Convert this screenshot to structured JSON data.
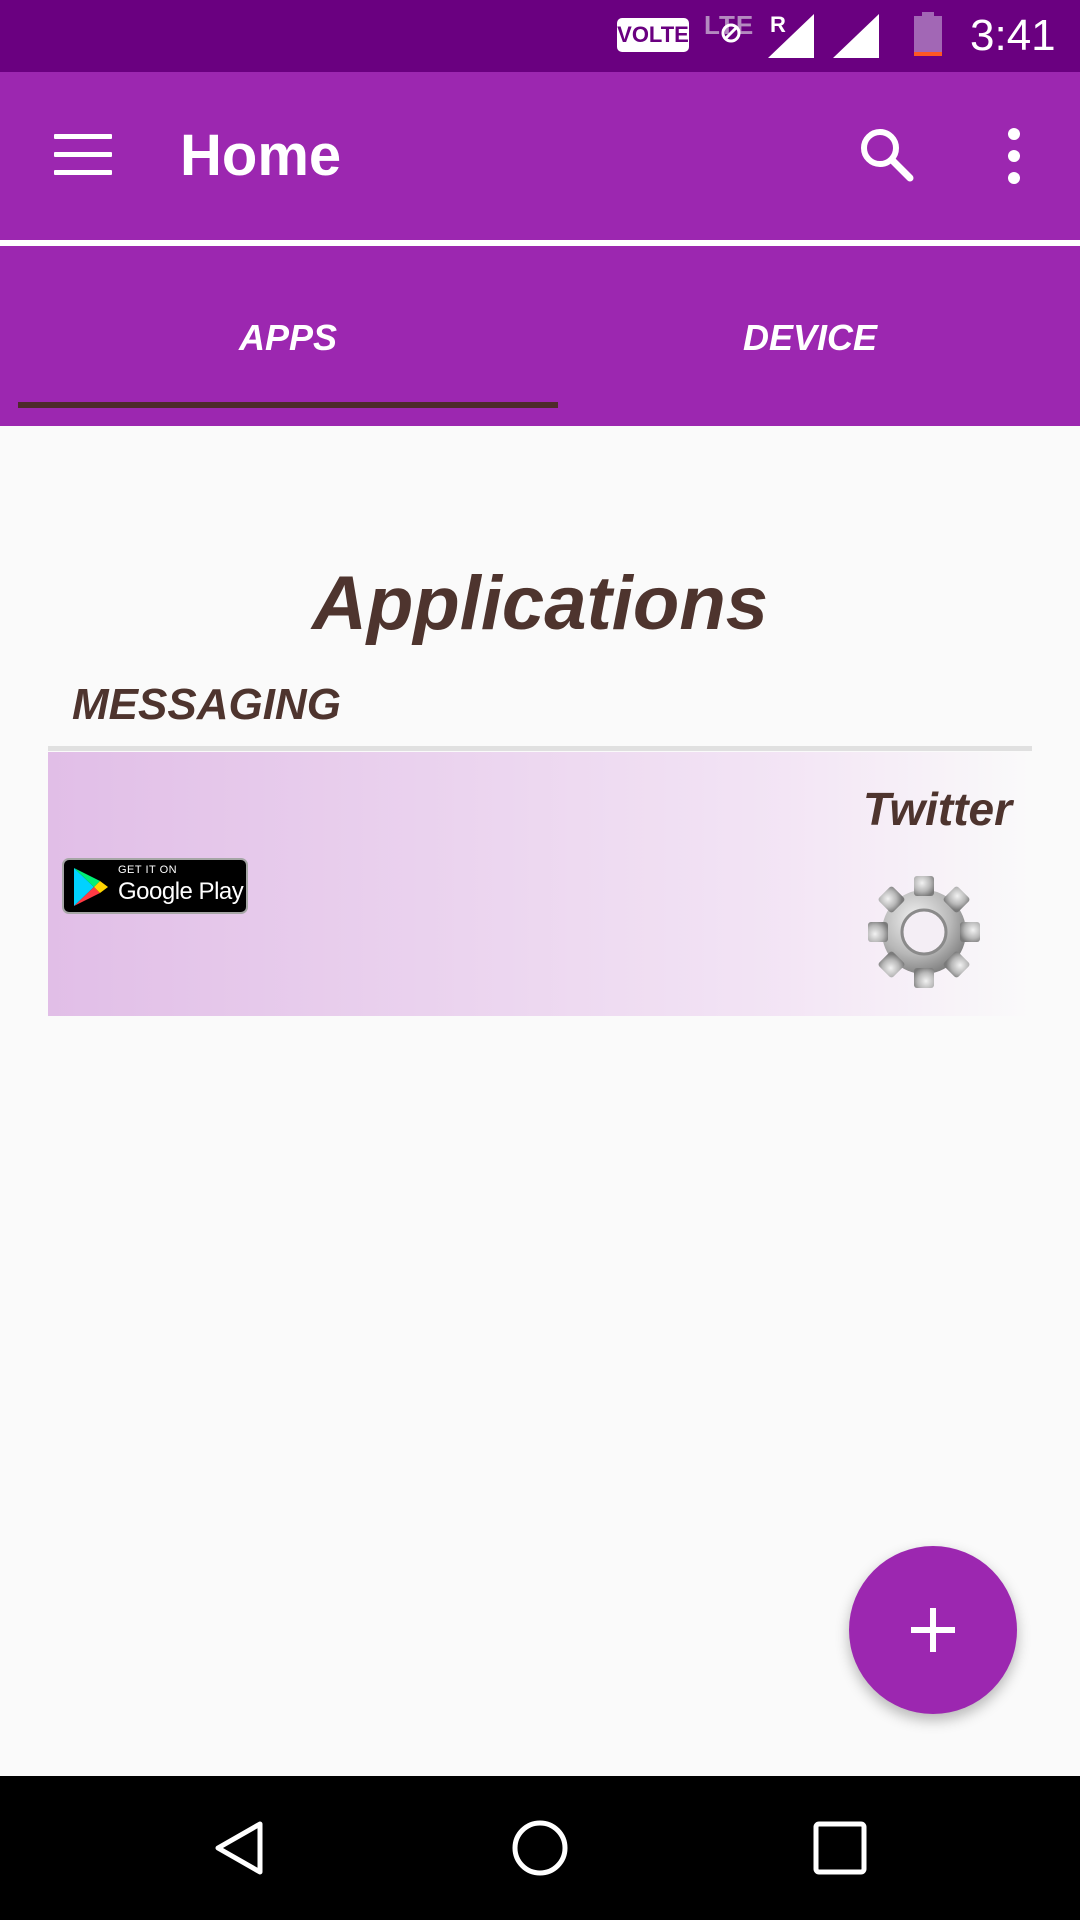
{
  "status_bar": {
    "volte": "VOLTE",
    "lte": "LTE",
    "roaming": "R",
    "time": "3:41",
    "icons": [
      "volte-icon",
      "lte-icon",
      "signal-icon",
      "signal-icon",
      "battery-low-icon"
    ]
  },
  "app_bar": {
    "title": "Home",
    "icons": [
      "menu-icon",
      "search-icon",
      "more-vert-icon"
    ]
  },
  "tabs": [
    {
      "label": "APPS",
      "selected": true
    },
    {
      "label": "DEVICE",
      "selected": false
    }
  ],
  "main": {
    "heading": "Applications",
    "section": "MESSAGING",
    "app_card": {
      "name": "Twitter",
      "badge_small": "GET IT ON",
      "badge_large": "Google Play",
      "icons": [
        "google-play-icon",
        "gear-icon"
      ]
    }
  },
  "fab": {
    "icon": "plus-icon"
  },
  "nav_bar": {
    "icons": [
      "back-icon",
      "home-icon",
      "recents-icon"
    ]
  },
  "colors": {
    "status_bar": "#6a0080",
    "primary": "#9c27b0",
    "text_brown": "#4e342e",
    "card_start": "#e1bee7",
    "background": "#fafafa"
  }
}
